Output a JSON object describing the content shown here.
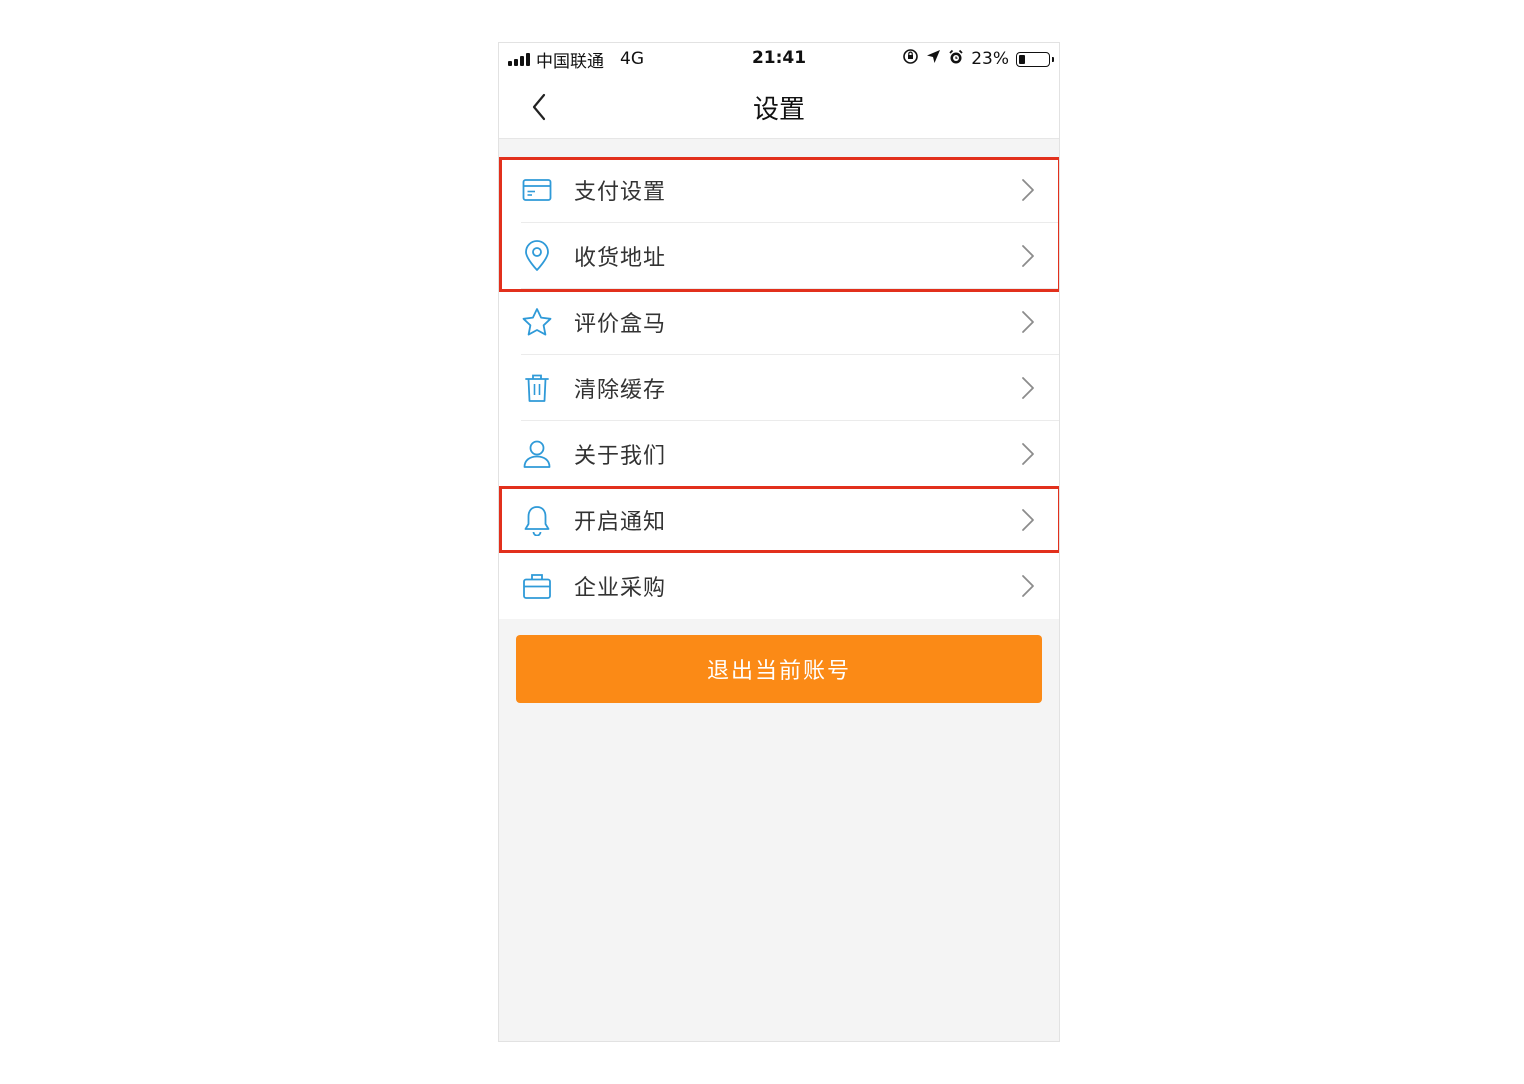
{
  "status_bar": {
    "carrier": "中国联通",
    "network": "4G",
    "time": "21:41",
    "battery_percent": "23%",
    "battery_level": 0.23,
    "icons": [
      "signal-icon",
      "orientation-lock-icon",
      "location-icon",
      "alarm-icon",
      "battery-icon"
    ]
  },
  "navbar": {
    "title": "设置",
    "back_icon": "chevron-left-icon"
  },
  "menu": {
    "items": [
      {
        "label": "支付设置",
        "icon": "card-icon"
      },
      {
        "label": "收货地址",
        "icon": "location-pin-icon"
      },
      {
        "label": "评价盒马",
        "icon": "star-icon"
      },
      {
        "label": "清除缓存",
        "icon": "trash-icon"
      },
      {
        "label": "关于我们",
        "icon": "user-icon"
      },
      {
        "label": "开启通知",
        "icon": "bell-icon"
      },
      {
        "label": "企业采购",
        "icon": "briefcase-icon"
      }
    ],
    "highlighted_groups": [
      [
        "支付设置",
        "收货地址"
      ],
      [
        "开启通知"
      ]
    ]
  },
  "logout_button": {
    "label": "退出当前账号"
  },
  "colors": {
    "accent_icon": "#2f9ad8",
    "logout_bg": "#fb8a16",
    "highlight_border": "#e2301c",
    "page_bg": "#f4f4f4"
  }
}
